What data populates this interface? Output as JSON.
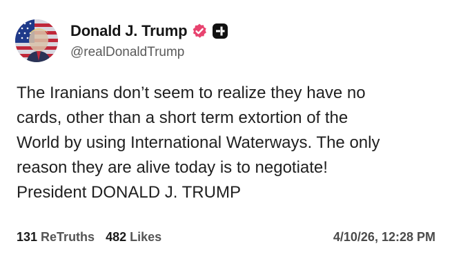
{
  "author": {
    "display_name": "Donald J. Trump",
    "handle": "@realDonaldTrump",
    "avatar_icon": "flag-portrait-avatar",
    "verified_icon": "verified-badge-icon",
    "platform_icon": "truth-social-icon",
    "colors": {
      "verified": "#e8436f",
      "platform": "#111111"
    }
  },
  "post": {
    "text": "The Iranians don’t seem to realize they have no\ncards, other than a short term extortion of the\nWorld by using International Waterways. The only\nreason they are alive today is to negotiate!\nPresident DONALD J. TRUMP"
  },
  "stats": {
    "retruths_count": "131",
    "retruths_label": "ReTruths",
    "likes_count": "482",
    "likes_label": "Likes",
    "timestamp": "4/10/26, 12:28 PM"
  }
}
